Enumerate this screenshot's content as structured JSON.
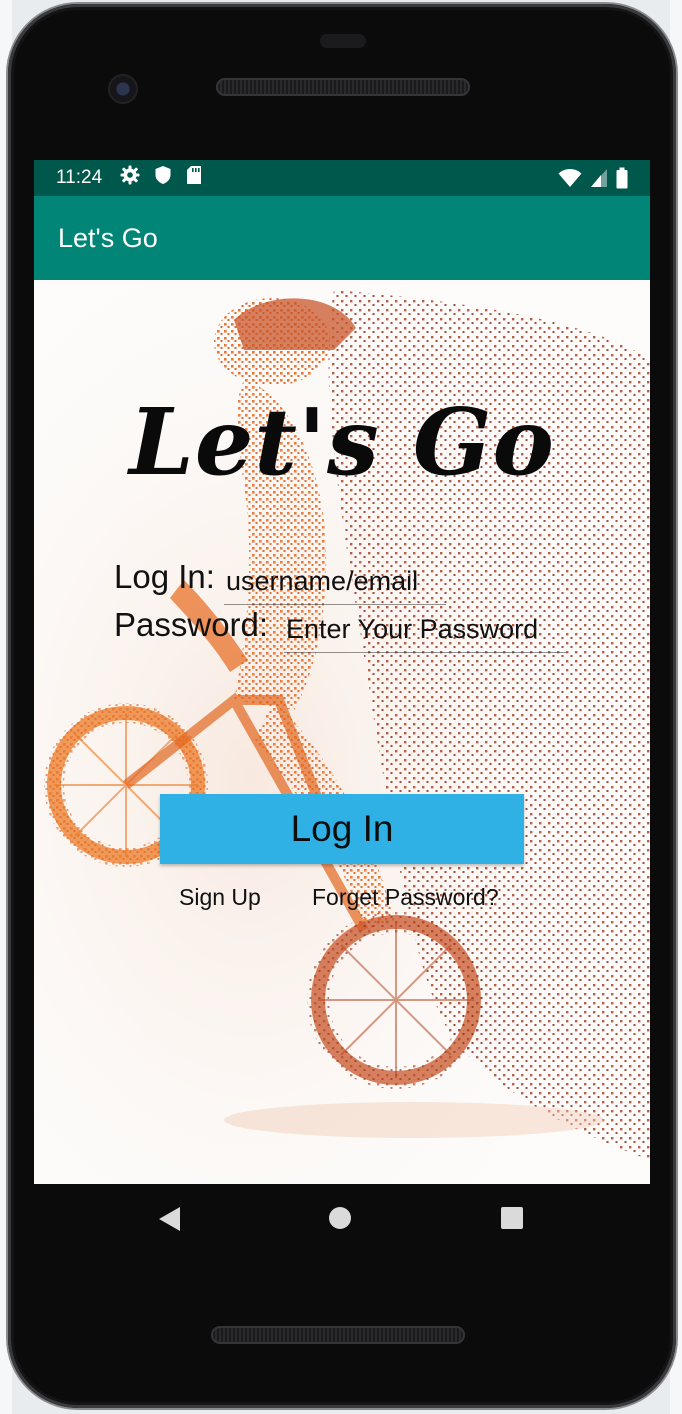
{
  "status_bar": {
    "time": "11:24",
    "left_icons": [
      "gear-icon",
      "shield-icon",
      "sd-card-icon"
    ],
    "right_icons": [
      "wifi-icon",
      "signal-icon",
      "battery-icon"
    ]
  },
  "app_bar": {
    "title": "Let's Go"
  },
  "hero": {
    "headline": "Let's Go"
  },
  "login_form": {
    "username_label": "Log In:",
    "username_placeholder": "username/email",
    "password_label": "Password:",
    "password_placeholder": "Enter Your Password",
    "submit_label": "Log In",
    "signup_link": "Sign Up",
    "forgot_link": "Forget Password?"
  },
  "nav_bar": {
    "buttons": [
      "back-icon",
      "home-icon",
      "recents-icon"
    ]
  },
  "colors": {
    "status_bar": "#00574b",
    "app_bar": "#008577",
    "login_button": "#2fb1e6"
  }
}
